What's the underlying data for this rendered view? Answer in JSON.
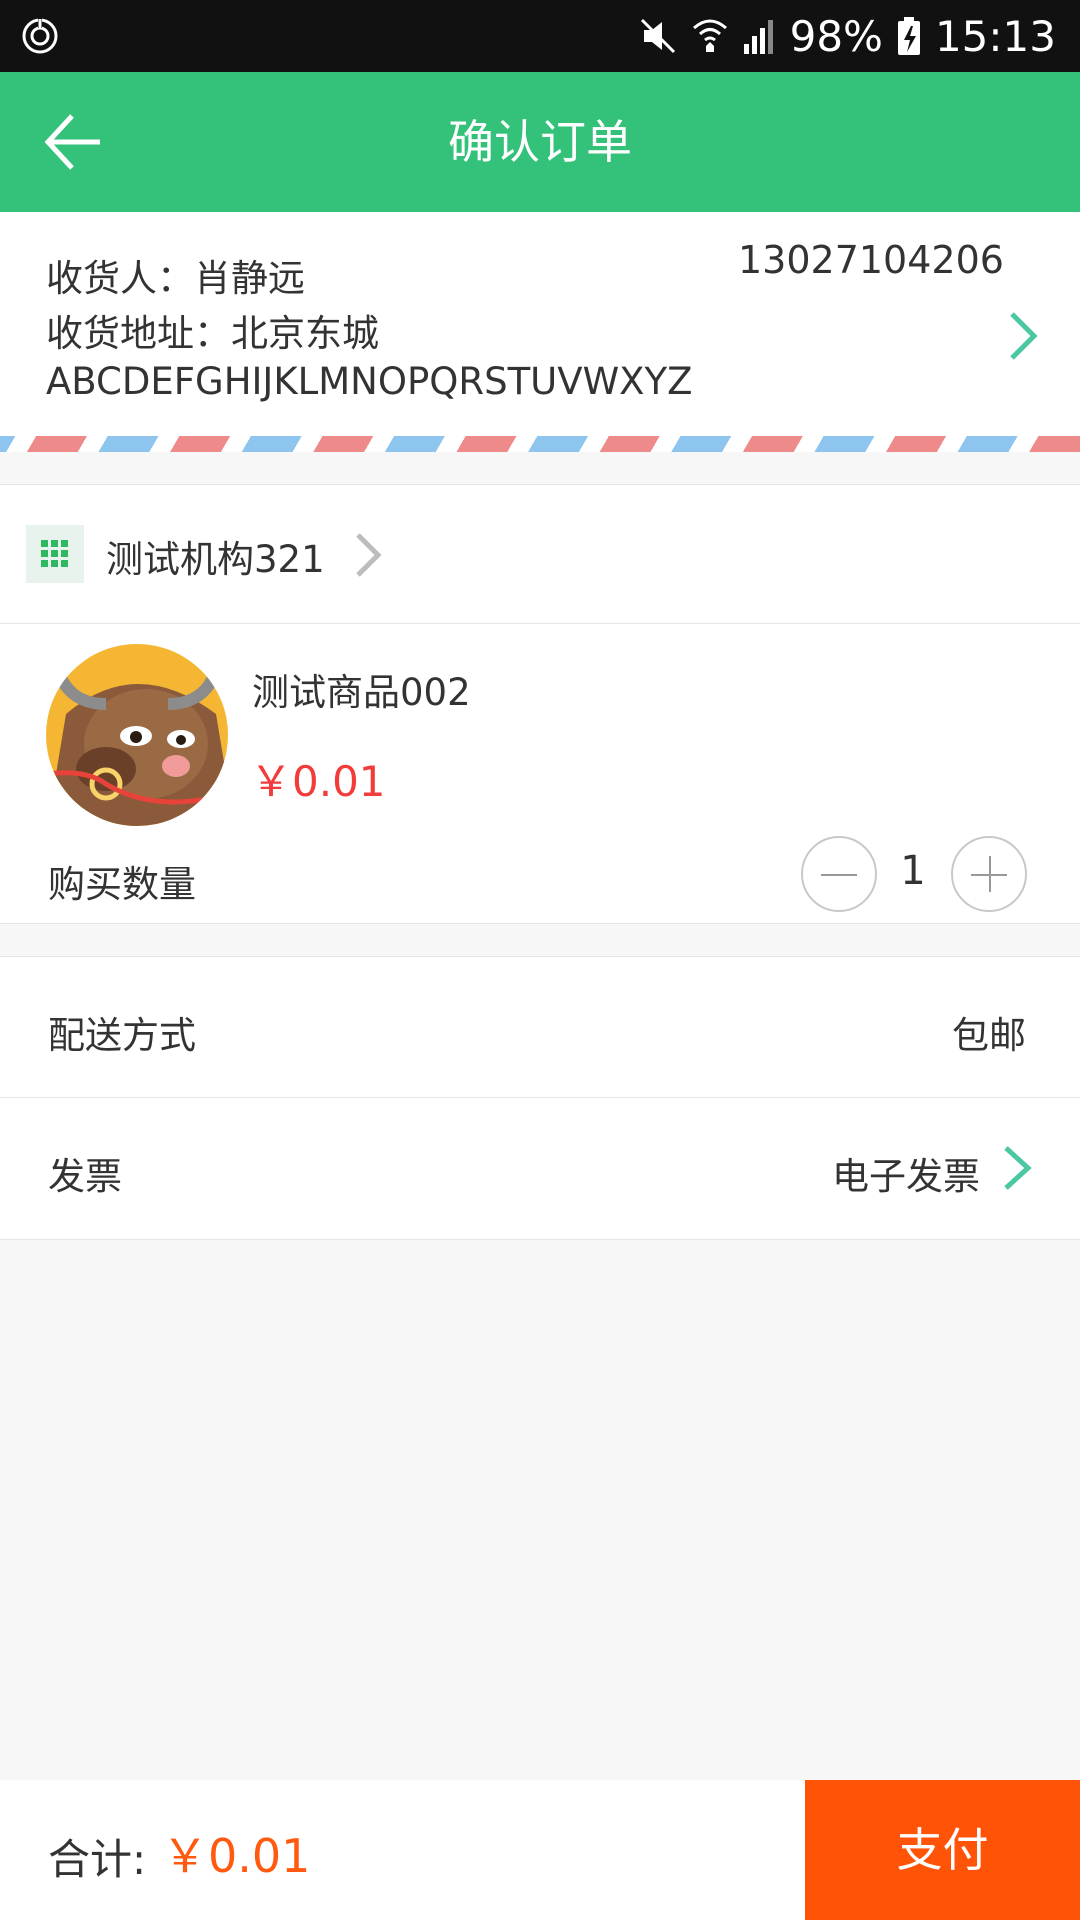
{
  "status_bar": {
    "battery": "98%",
    "time": "15:13",
    "icons": [
      "alarm-icon",
      "mute-icon",
      "wifi-icon",
      "signal-icon",
      "battery-charging-icon"
    ]
  },
  "app_bar": {
    "title": "确认订单",
    "back_icon": "arrow-left-icon",
    "background_color": "#34c27a"
  },
  "address": {
    "receiver": "收货人：肖静远",
    "phone": "13027104206",
    "address_line1": "收货地址：北京东城",
    "address_line2": "ABCDEFGHIJKLMNOPQRSTUVWXYZ"
  },
  "shop": {
    "name": "测试机构321"
  },
  "product": {
    "name": "测试商品002",
    "price": "￥0.01",
    "quantity_label": "购买数量",
    "quantity": "1"
  },
  "delivery": {
    "label": "配送方式",
    "value": "包邮"
  },
  "invoice": {
    "label": "发票",
    "value": "电子发票"
  },
  "bottom_bar": {
    "total_label": "合计:",
    "total_value": "￥0.01",
    "pay_label": "支付",
    "pay_color": "#ff5408"
  },
  "colors": {
    "accent_green": "#34c27a",
    "price_red": "#f23b3b",
    "total_orange": "#ff5a0f"
  }
}
